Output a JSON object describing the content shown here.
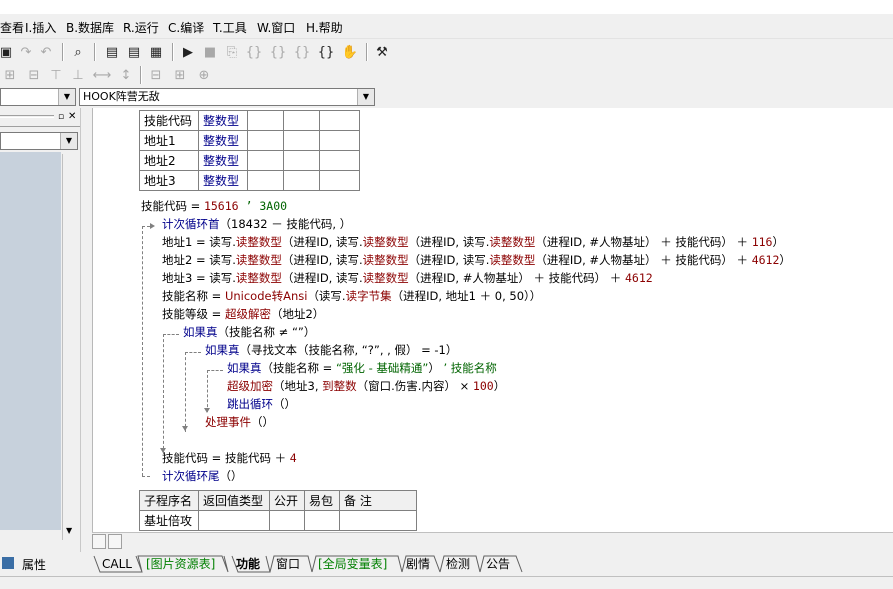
{
  "menu": {
    "view": "查看",
    "insert": "I.插入",
    "database": "B.数据库",
    "run": "R.运行",
    "compile": "C.编译",
    "tools": "T.工具",
    "window": "W.窗口",
    "help": "H.帮助"
  },
  "combos": {
    "method": "HOOK阵营无敌"
  },
  "var_table": [
    {
      "name": "技能代码",
      "type": "整数型"
    },
    {
      "name": "地址1",
      "type": "整数型"
    },
    {
      "name": "地址2",
      "type": "整数型"
    },
    {
      "name": "地址3",
      "type": "整数型"
    }
  ],
  "code": {
    "l1_a": "技能代码",
    "l1_b": " = ",
    "l1_num": "15616",
    "l1_cmt": "  ’ 3A00",
    "l2_kw": "计次循环首",
    "l2_rest": "（18432 － 技能代码, ）",
    "l3_a": "地址1 = 读写.",
    "l3_f1": "读整数型",
    "l3_b": "（进程ID, 读写.",
    "l3_f2": "读整数型",
    "l3_c": "（进程ID, 读写.",
    "l3_f3": "读整数型",
    "l3_d": "（进程ID, #人物基址） ＋ 技能代码） ＋ ",
    "l3_num": "116",
    "l3_e": "）",
    "l4_a": "地址2 = 读写.",
    "l4_f1": "读整数型",
    "l4_b": "（进程ID, 读写.",
    "l4_f2": "读整数型",
    "l4_c": "（进程ID, 读写.",
    "l4_f3": "读整数型",
    "l4_d": "（进程ID, #人物基址） ＋ 技能代码） ＋ ",
    "l4_num": "4612",
    "l4_e": "）",
    "l5_a": "地址3 = 读写.",
    "l5_f1": "读整数型",
    "l5_b": "（进程ID, 读写.",
    "l5_f2": "读整数型",
    "l5_c": "（进程ID, #人物基址） ＋ 技能代码） ＋ ",
    "l5_num": "4612",
    "l6_a": "技能名称 = ",
    "l6_f1": "Unicode转Ansi",
    "l6_b": "（读写.",
    "l6_f2": "读字节集",
    "l6_c": "（进程ID, 地址1 ＋ 0, 50））",
    "l7_a": "技能等级 = ",
    "l7_f1": "超级解密",
    "l7_b": "（地址2）",
    "l8_kw": "如果真",
    "l8_rest": "（技能名称 ≠ “”）",
    "l9_kw": "如果真",
    "l9_rest": "（寻找文本（技能名称, “?”, , 假） = -1）",
    "l10_kw": "如果真",
    "l10_a": "（技能名称 = ",
    "l10_str": "“强化 - 基础精通”",
    "l10_b": "）",
    "l10_cmt": "  ’ 技能名称",
    "l11_f1": "超级加密",
    "l11_a": "（地址3, ",
    "l11_f2": "到整数",
    "l11_b": "（窗口.伤害.内容） × ",
    "l11_num": "100",
    "l11_c": "）",
    "l12_kw": "跳出循环",
    "l12_rest": "（）",
    "l13_f1": "处理事件",
    "l13_rest": "（）",
    "l14_a": "技能代码 = 技能代码 ＋ ",
    "l14_num": "4",
    "l15_kw": "计次循环尾",
    "l15_rest": "（）"
  },
  "sub_table": {
    "headers": [
      "子程序名",
      "返回值类型",
      "公开",
      "易包",
      "备 注"
    ],
    "row": [
      "基址倍攻",
      "",
      "",
      "",
      ""
    ]
  },
  "left_tab": "属性",
  "tabs": [
    "CALL",
    "[图片资源表]",
    "功能",
    "窗口",
    "[全局变量表]",
    "剧情",
    "检测",
    "公告"
  ]
}
